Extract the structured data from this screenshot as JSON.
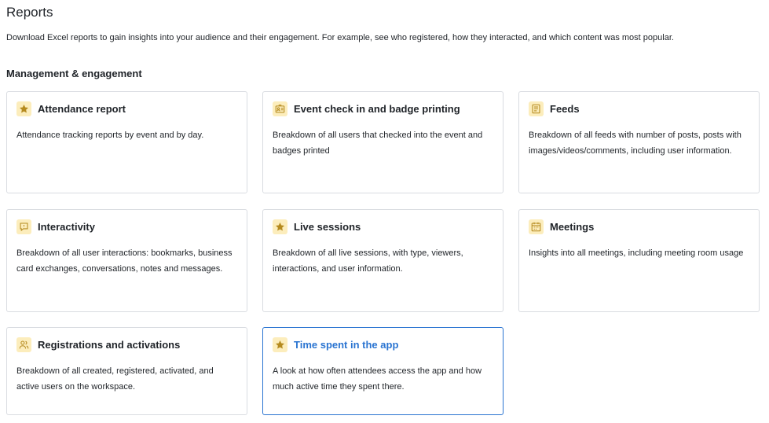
{
  "page": {
    "title": "Reports",
    "description": "Download Excel reports to gain insights into your audience and their engagement. For example, see who registered, how they interacted, and which content was most popular."
  },
  "section": {
    "title": "Management & engagement"
  },
  "colors": {
    "icon_bg": "#fcedbc",
    "icon_fg": "#b58a1e",
    "active_border": "#2a74d1",
    "card_border": "#d9dce1"
  },
  "cards": [
    {
      "title": "Attendance report",
      "icon": "star-icon",
      "description": "Attendance tracking reports by event and by day."
    },
    {
      "title": "Event check in and badge printing",
      "icon": "badge-icon",
      "description": "Breakdown of all users that checked into the event and badges printed"
    },
    {
      "title": "Feeds",
      "icon": "feed-icon",
      "description": "Breakdown of all feeds with number of posts, posts with images/videos/comments, including user information."
    },
    {
      "title": "Interactivity",
      "icon": "chat-icon",
      "description": "Breakdown of all user interactions: bookmarks, business card exchanges, conversations, notes and messages."
    },
    {
      "title": "Live sessions",
      "icon": "star-icon",
      "description": "Breakdown of all live sessions, with type, viewers, interactions, and user information."
    },
    {
      "title": "Meetings",
      "icon": "calendar-icon",
      "description": "Insights into all meetings, including meeting room usage"
    },
    {
      "title": "Registrations and activations",
      "icon": "users-icon",
      "description": "Breakdown of all created, registered, activated, and active users on the workspace."
    },
    {
      "title": "Time spent in the app",
      "icon": "star-icon",
      "description": "A look at how often attendees access the app and how much active time they spent there."
    }
  ]
}
